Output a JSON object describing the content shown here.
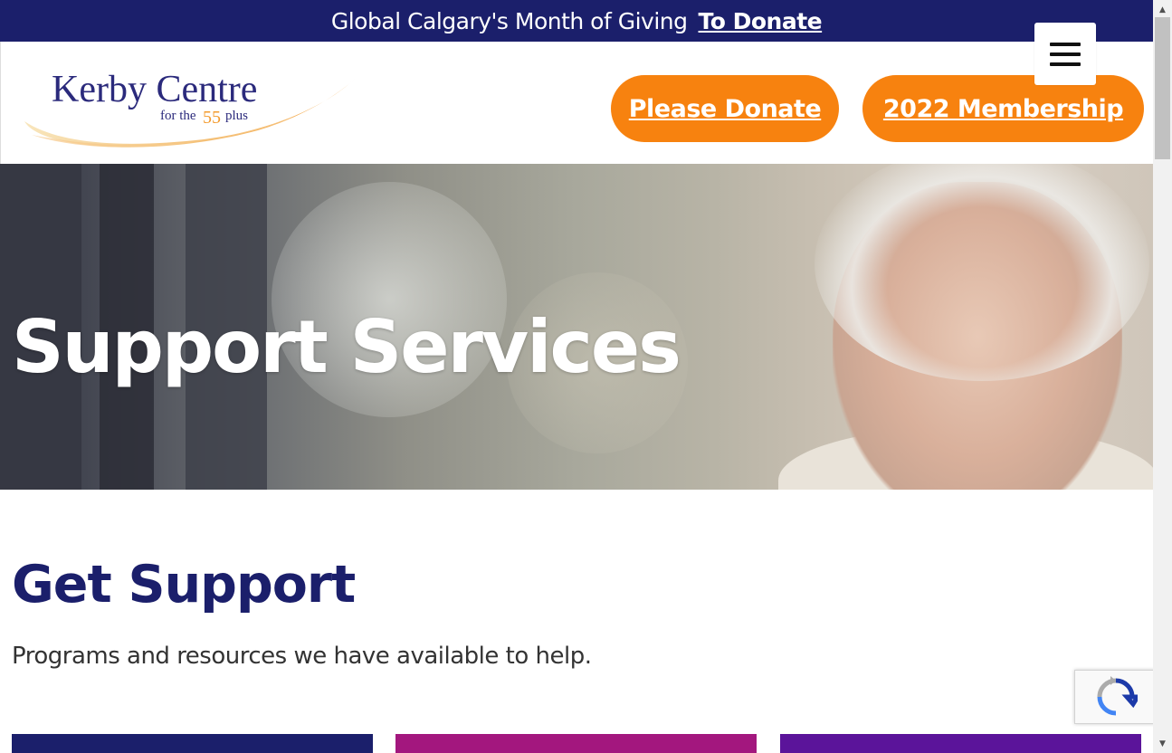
{
  "colors": {
    "navy": "#1b1f6b",
    "orange": "#f7820f",
    "magenta": "#a3177e",
    "purple": "#5b149a",
    "logo_navy": "#2b2a7c",
    "logo_orange": "#f39a2c"
  },
  "topbar": {
    "message": "Global Calgary's Month of Giving",
    "link": "To Donate"
  },
  "header": {
    "logo": {
      "name": "Kerby Centre",
      "tagline_prefix": "for the",
      "tagline_number": "55",
      "tagline_suffix": "plus"
    },
    "menu_icon": "hamburger-icon",
    "donate_button": "Please Donate",
    "membership_button": "2022 Membership"
  },
  "hero": {
    "title": "Support Services"
  },
  "content": {
    "title": "Get Support",
    "subtitle": "Programs and resources we have available to help.",
    "cards": [
      {
        "color": "#1b1f6b"
      },
      {
        "color": "#a3177e"
      },
      {
        "color": "#5b149a"
      }
    ]
  },
  "recaptcha": {
    "icon": "recaptcha-icon"
  },
  "scrollbar": {
    "up_icon": "arrow-up-icon",
    "down_icon": "arrow-down-icon"
  }
}
